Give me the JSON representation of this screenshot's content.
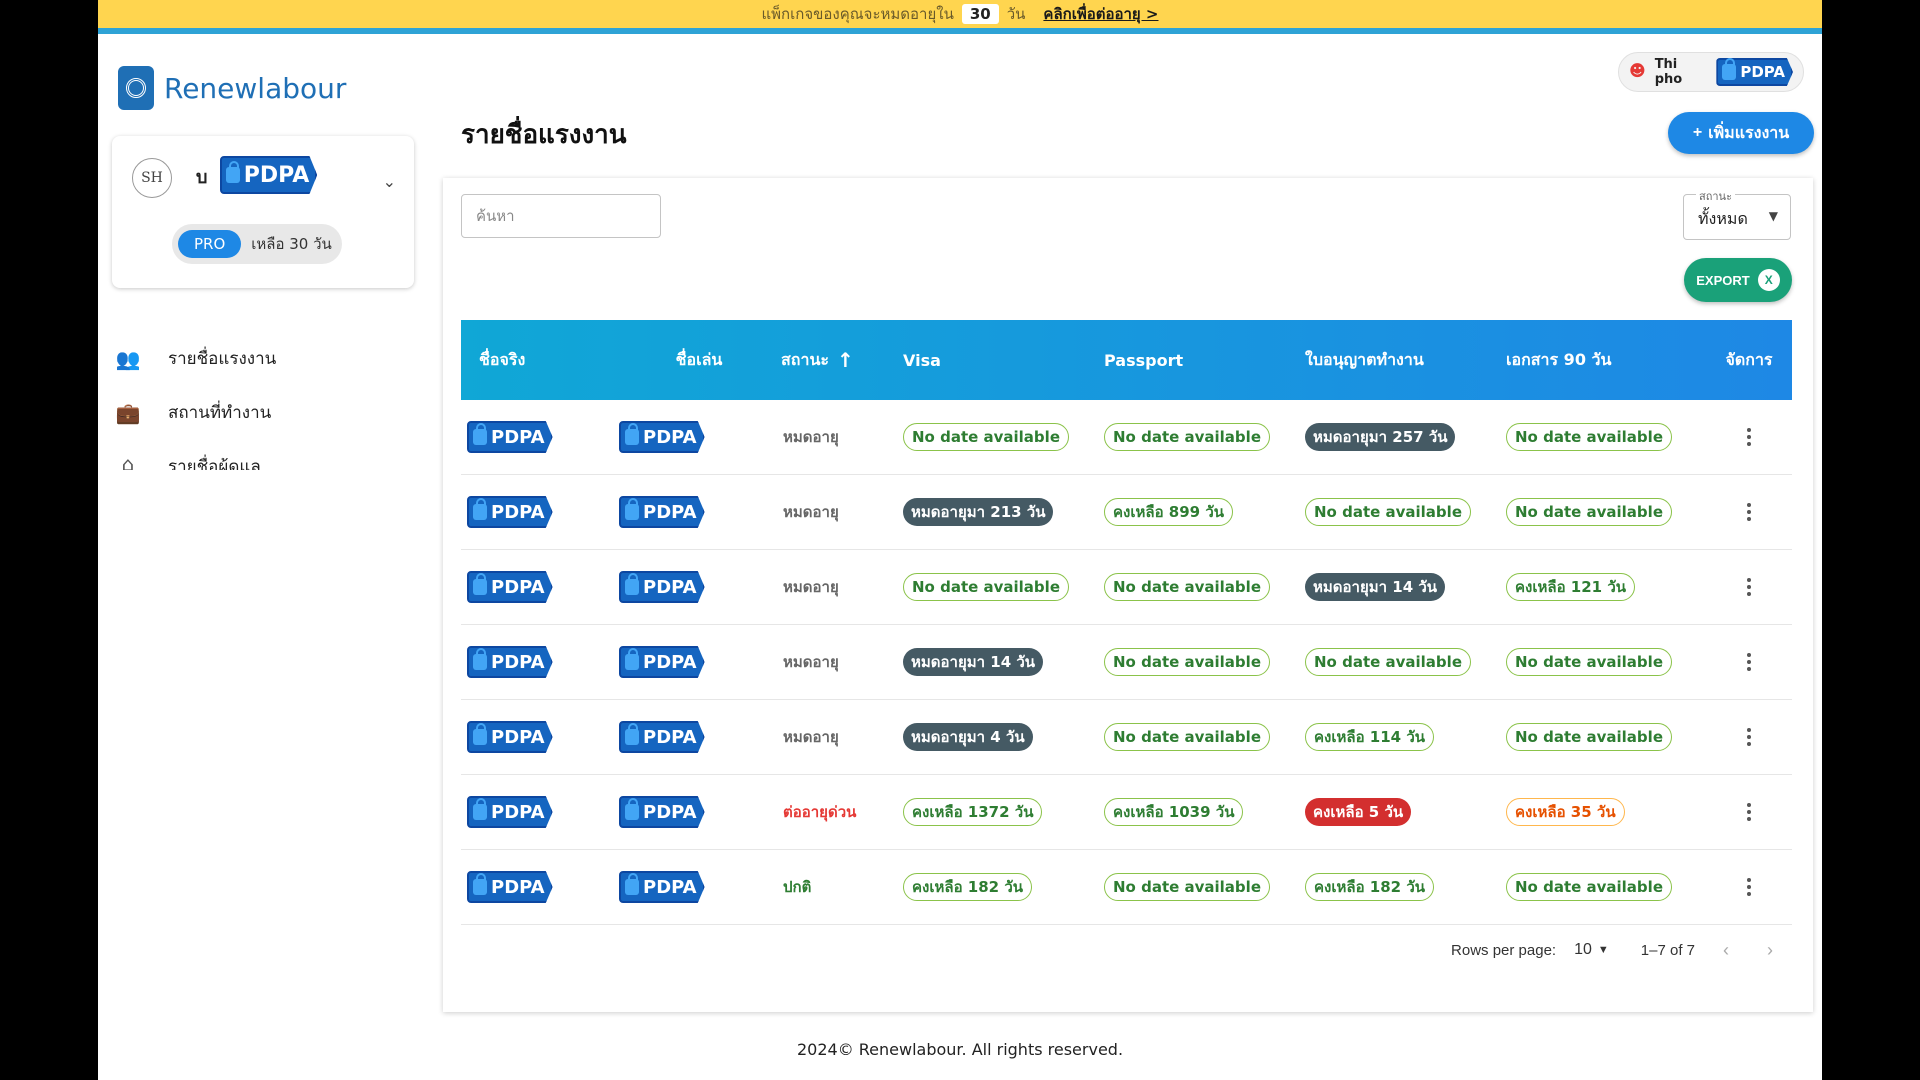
{
  "banner": {
    "prefix": "แพ็กเกจของคุณจะหมดอายุใน",
    "days": "30",
    "suffix": "วัน",
    "link": "คลิกเพื่อต่ออายุ >"
  },
  "brand": {
    "name": "Renewlabour",
    "color": "#1f6fb5"
  },
  "company": {
    "initials": "SH",
    "name": "บ",
    "plan": "PRO",
    "remaining": "เหลือ 30 วัน"
  },
  "sidebar": {
    "items": [
      {
        "label": "รายชื่อแรงงาน",
        "icon": "people-icon"
      },
      {
        "label": "สถานที่ทำงาน",
        "icon": "briefcase-icon"
      },
      {
        "label": "รายชื่อผู้ดูแล",
        "icon": "home-icon"
      }
    ]
  },
  "user": {
    "name": "Thi pho"
  },
  "page": {
    "title": "รายชื่อแรงงาน",
    "add_label": "เพิ่มแรงงาน"
  },
  "filters": {
    "search_placeholder": "ค้นหา",
    "status_label": "สถานะ",
    "status_value": "ทั้งหมด",
    "export_label": "EXPORT"
  },
  "table": {
    "columns": [
      "ชื่อจริง",
      "ชื่อเล่น",
      "สถานะ",
      "Visa",
      "Passport",
      "ใบอนุญาตทำงาน",
      "เอกสาร 90 วัน",
      "จัดการ"
    ],
    "pdpa_text": "PDPA",
    "rows": [
      {
        "status": "หมดอายุ",
        "status_type": "expired",
        "visa": {
          "text": "No date available",
          "type": "na"
        },
        "passport": {
          "text": "No date available",
          "type": "na"
        },
        "work": {
          "text": "หมดอายุมา 257 วัน",
          "type": "expired"
        },
        "doc": {
          "text": "No date available",
          "type": "na"
        }
      },
      {
        "status": "หมดอายุ",
        "status_type": "expired",
        "visa": {
          "text": "หมดอายุมา 213 วัน",
          "type": "expired"
        },
        "passport": {
          "text": "คงเหลือ 899 วัน",
          "type": "ok"
        },
        "work": {
          "text": "No date available",
          "type": "na"
        },
        "doc": {
          "text": "No date available",
          "type": "na"
        }
      },
      {
        "status": "หมดอายุ",
        "status_type": "expired",
        "visa": {
          "text": "No date available",
          "type": "na"
        },
        "passport": {
          "text": "No date available",
          "type": "na"
        },
        "work": {
          "text": "หมดอายุมา 14 วัน",
          "type": "expired"
        },
        "doc": {
          "text": "คงเหลือ 121 วัน",
          "type": "ok"
        }
      },
      {
        "status": "หมดอายุ",
        "status_type": "expired",
        "visa": {
          "text": "หมดอายุมา 14 วัน",
          "type": "expired"
        },
        "passport": {
          "text": "No date available",
          "type": "na"
        },
        "work": {
          "text": "No date available",
          "type": "na"
        },
        "doc": {
          "text": "No date available",
          "type": "na"
        }
      },
      {
        "status": "หมดอายุ",
        "status_type": "expired",
        "visa": {
          "text": "หมดอายุมา 4 วัน",
          "type": "expired"
        },
        "passport": {
          "text": "No date available",
          "type": "na"
        },
        "work": {
          "text": "คงเหลือ 114 วัน",
          "type": "ok"
        },
        "doc": {
          "text": "No date available",
          "type": "na"
        }
      },
      {
        "status": "ต่ออายุด่วน",
        "status_type": "urgent",
        "visa": {
          "text": "คงเหลือ 1372 วัน",
          "type": "ok"
        },
        "passport": {
          "text": "คงเหลือ 1039 วัน",
          "type": "ok"
        },
        "work": {
          "text": "คงเหลือ 5 วัน",
          "type": "danger"
        },
        "doc": {
          "text": "คงเหลือ 35 วัน",
          "type": "warn"
        }
      },
      {
        "status": "ปกติ",
        "status_type": "normal",
        "visa": {
          "text": "คงเหลือ 182 วัน",
          "type": "ok"
        },
        "passport": {
          "text": "No date available",
          "type": "na"
        },
        "work": {
          "text": "คงเหลือ 182 วัน",
          "type": "ok"
        },
        "doc": {
          "text": "No date available",
          "type": "na"
        }
      }
    ]
  },
  "pagination": {
    "rows_label": "Rows per page:",
    "rows_value": "10",
    "range": "1–7 of 7"
  },
  "footer": {
    "text": "2024© Renewlabour. All rights reserved."
  },
  "colors": {
    "banner_bg": "#ffd54f",
    "accent": "#1e88e5",
    "export": "#1aa179",
    "urgent": "#e53935",
    "normal": "#2e7d32"
  }
}
